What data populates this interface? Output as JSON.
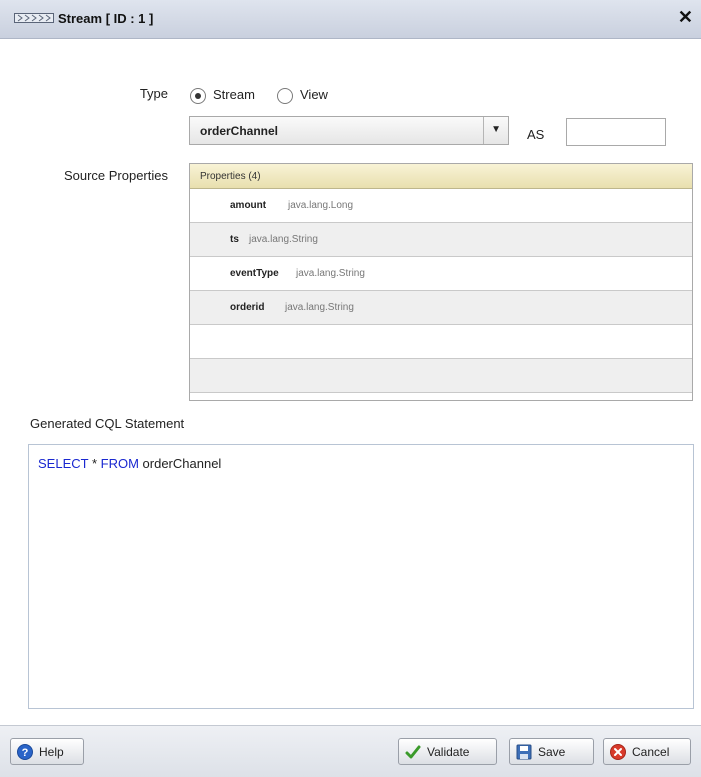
{
  "dialog": {
    "title": "Stream [ ID : 1 ]",
    "icon": "stream-icon",
    "close_icon": "close-icon"
  },
  "type_row": {
    "label": "Type",
    "options": [
      {
        "label": "Stream",
        "selected": true
      },
      {
        "label": "View",
        "selected": false
      }
    ]
  },
  "source_select": {
    "value": "orderChannel",
    "as_label": "AS",
    "as_value": ""
  },
  "source_properties": {
    "label": "Source Properties",
    "header": "Properties (4)",
    "rows": [
      {
        "name": "amount",
        "type": "java.lang.Long"
      },
      {
        "name": "ts",
        "type": "java.lang.String"
      },
      {
        "name": "eventType",
        "type": "java.lang.String"
      },
      {
        "name": "orderid",
        "type": "java.lang.String"
      }
    ]
  },
  "cql": {
    "label": "Generated CQL Statement",
    "kw_select": "SELECT",
    "star": " * ",
    "kw_from": "FROM",
    "source": " orderChannel"
  },
  "footer": {
    "help": "Help",
    "validate": "Validate",
    "save": "Save",
    "cancel": "Cancel"
  },
  "colors": {
    "keyword": "#1a28d0",
    "header_bg": "#e8dfae"
  }
}
